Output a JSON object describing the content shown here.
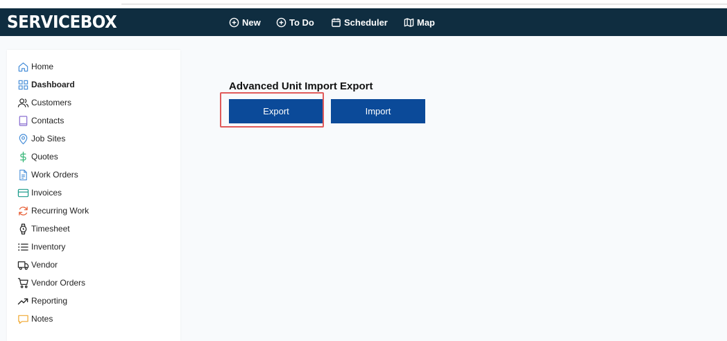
{
  "header": {
    "logo": "SERVICEBOX",
    "nav": [
      {
        "label": "New",
        "icon": "plus-circle-icon"
      },
      {
        "label": "To Do",
        "icon": "plus-circle-icon"
      },
      {
        "label": "Scheduler",
        "icon": "calendar-icon"
      },
      {
        "label": "Map",
        "icon": "map-icon"
      }
    ]
  },
  "sidebar": {
    "items": [
      {
        "label": "Home",
        "icon": "home-icon"
      },
      {
        "label": "Dashboard",
        "icon": "grid-icon"
      },
      {
        "label": "Customers",
        "icon": "users-icon"
      },
      {
        "label": "Contacts",
        "icon": "book-icon"
      },
      {
        "label": "Job Sites",
        "icon": "map-pin-icon"
      },
      {
        "label": "Quotes",
        "icon": "dollar-icon"
      },
      {
        "label": "Work Orders",
        "icon": "document-icon"
      },
      {
        "label": "Invoices",
        "icon": "credit-card-icon"
      },
      {
        "label": "Recurring Work",
        "icon": "refresh-icon"
      },
      {
        "label": "Timesheet",
        "icon": "watch-icon"
      },
      {
        "label": "Inventory",
        "icon": "list-icon"
      },
      {
        "label": "Vendor",
        "icon": "truck-icon"
      },
      {
        "label": "Vendor Orders",
        "icon": "cart-icon"
      },
      {
        "label": "Reporting",
        "icon": "trending-up-icon"
      },
      {
        "label": "Notes",
        "icon": "message-icon"
      }
    ]
  },
  "main": {
    "title": "Advanced Unit Import Export",
    "export_label": "Export",
    "import_label": "Import"
  },
  "colors": {
    "header_bg": "#0f2d40",
    "button_bg": "#0b4a99",
    "highlight": "#e05a5a"
  }
}
